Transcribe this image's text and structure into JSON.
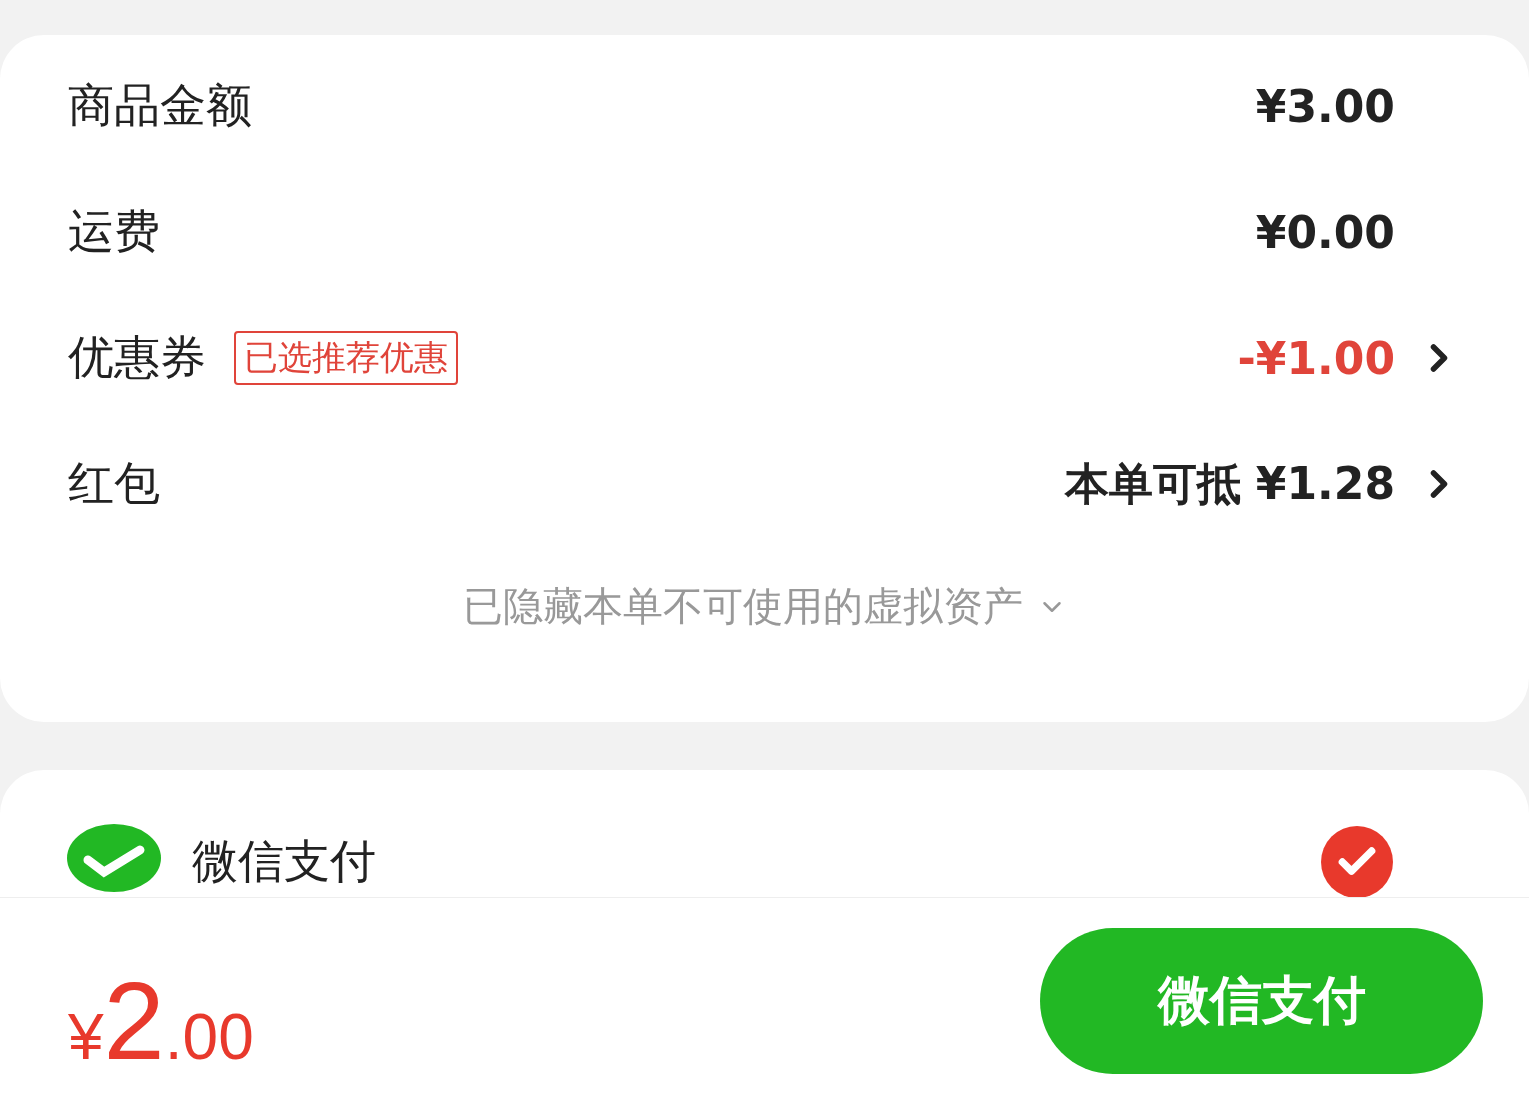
{
  "summary": {
    "rows": [
      {
        "kind": "plain",
        "label": "商品金额",
        "value": "¥3.00"
      },
      {
        "kind": "plain",
        "label": "运费",
        "value": "¥0.00"
      },
      {
        "kind": "discount",
        "label": "优惠券",
        "tag": "已选推荐优惠",
        "value": "-¥1.00"
      },
      {
        "kind": "link",
        "label": "红包",
        "value": "本单可抵 ¥1.28"
      }
    ],
    "hint": "已隐藏本单不可使用的虚拟资产"
  },
  "payment": {
    "methods": [
      {
        "name": "微信支付",
        "selected": true
      }
    ]
  },
  "footer": {
    "total": {
      "currency": "¥",
      "integer": "2",
      "decimal": ".00"
    },
    "button": "微信支付"
  }
}
